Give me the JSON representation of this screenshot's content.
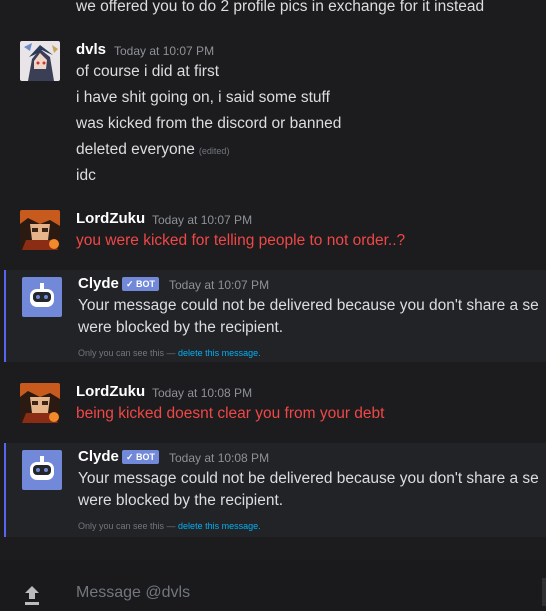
{
  "top_line": "we offered you to do 2 profile pics in exchange for it instead",
  "messages": [
    {
      "author": "dvls",
      "time": "Today at 10:07 PM",
      "lines": [
        "of course i did at first",
        "i have shit going on, i said some stuff",
        "was kicked from the discord or banned",
        "deleted everyone",
        "idc"
      ],
      "edited_label": "(edited)"
    },
    {
      "author": "LordZuku",
      "time": "Today at 10:07 PM",
      "lines": [
        "you were kicked for telling people to not order..?"
      ]
    },
    {
      "author": "Clyde",
      "badge": "BOT",
      "time": "Today at 10:07 PM",
      "lines": [
        "Your message could not be delivered because you don't share a se",
        "were blocked by the recipient."
      ],
      "note": "Only you can see this — ",
      "note_link": "delete this message."
    },
    {
      "author": "LordZuku",
      "time": "Today at 10:08 PM",
      "lines": [
        "being kicked doesnt clear you from your debt"
      ]
    },
    {
      "author": "Clyde",
      "badge": "BOT",
      "time": "Today at 10:08 PM",
      "lines": [
        "Your message could not be delivered because you don't share a se",
        "were blocked by the recipient."
      ],
      "note": "Only you can see this — ",
      "note_link": "delete this message."
    }
  ],
  "composer": {
    "placeholder": "Message @dvls",
    "icon": "upload-icon"
  },
  "colors": {
    "background": "#1c1c1e",
    "username": "#ffffff",
    "red_text": "#f04747",
    "bot_badge": "#7289da",
    "link": "#00b0f4",
    "bot_accent": "#5865f2"
  }
}
